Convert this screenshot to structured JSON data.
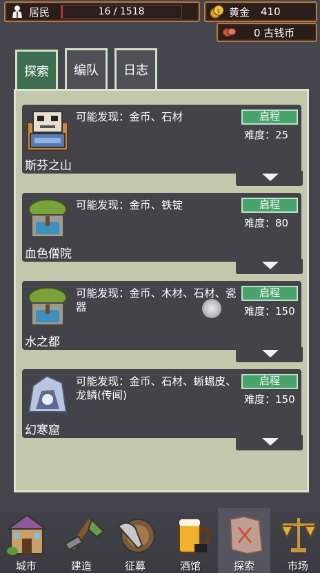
{
  "resources": {
    "residents_label": "居民",
    "residents_value": "16 / 1518",
    "residents_fraction": 0.0105,
    "gold_label": "黄金",
    "gold_value": "410",
    "coins_value": "0 古钱币"
  },
  "tabs": [
    {
      "label": "探索",
      "active": true
    },
    {
      "label": "编队",
      "active": false
    },
    {
      "label": "日志",
      "active": false
    }
  ],
  "expeditions": [
    {
      "name": "斯芬之山",
      "finds": "可能发现：金币、石材",
      "go": "启程",
      "difficulty": "难度：25",
      "icon": "sphinx-mountain-icon"
    },
    {
      "name": "血色僧院",
      "finds": "可能发现：金币、铁锭",
      "go": "启程",
      "difficulty": "难度：80",
      "icon": "scarlet-monastery-icon"
    },
    {
      "name": "水之都",
      "finds": "可能发现：金币、木材、石材、瓷器",
      "go": "启程",
      "difficulty": "难度：150",
      "icon": "water-capital-icon"
    },
    {
      "name": "幻寒窟",
      "finds": "可能发现：金币、石材、蜥蜴皮、龙鳞(传闻)",
      "go": "启程",
      "difficulty": "难度：150",
      "icon": "frost-cave-icon"
    }
  ],
  "nav": [
    {
      "label": "城市",
      "icon": "city-icon"
    },
    {
      "label": "建造",
      "icon": "build-icon"
    },
    {
      "label": "征募",
      "icon": "recruit-icon"
    },
    {
      "label": "酒馆",
      "icon": "tavern-icon"
    },
    {
      "label": "探索",
      "icon": "explore-icon",
      "active": true
    },
    {
      "label": "市场",
      "icon": "market-icon"
    }
  ]
}
